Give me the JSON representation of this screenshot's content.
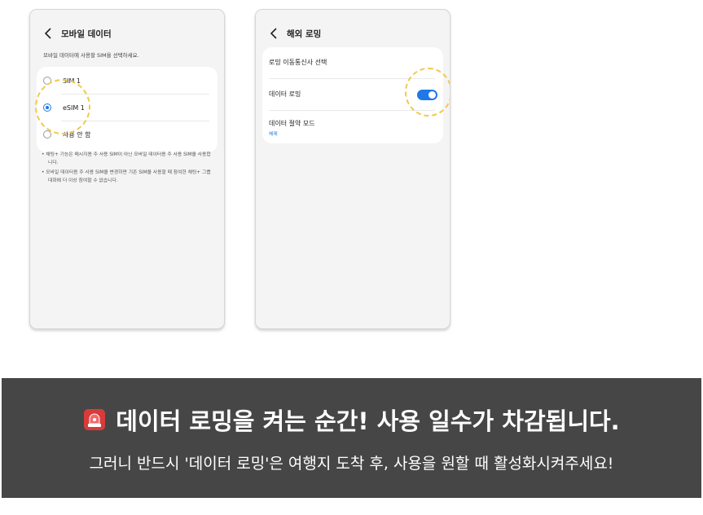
{
  "left_screen": {
    "title": "모바일 데이터",
    "subtitle": "모바일 데이터에 사용할 SIM을 선택하세요.",
    "options": [
      {
        "label": "SIM 1",
        "selected": false
      },
      {
        "label": "eSIM 1",
        "selected": true
      },
      {
        "label": "사용 안 함",
        "selected": false
      }
    ],
    "notes": [
      "• 채팅+ 기능은 메시지용 주 사용 SIM이 아닌 모바일 데이터용 주 사용 SIM을 사용합니다.",
      "• 모바일 데이터용 주 사용 SIM을 변경하면 기존 SIM을 사용할 때 참여한 채팅+ 그룹 대화에 더 이상 참여할 수 없습니다."
    ]
  },
  "right_screen": {
    "title": "해외 로밍",
    "items": [
      {
        "label": "로밍 이동통신사 선택"
      },
      {
        "label": "데이터 로밍",
        "toggle_on": true
      },
      {
        "label": "데이터 절약 모드",
        "sub": "해제"
      }
    ]
  },
  "banner": {
    "headline": "데이터 로밍을 켜는 순간! 사용 일수가 차감됩니다.",
    "subline": "그러니 반드시 '데이터 로밍'은 여행지 도착 후, 사용을 원할 때 활성화시켜주세요!",
    "icon": "siren-icon"
  },
  "colors": {
    "accent": "#1f78e5",
    "highlight": "#f2c94c",
    "banner_bg": "#464646"
  }
}
